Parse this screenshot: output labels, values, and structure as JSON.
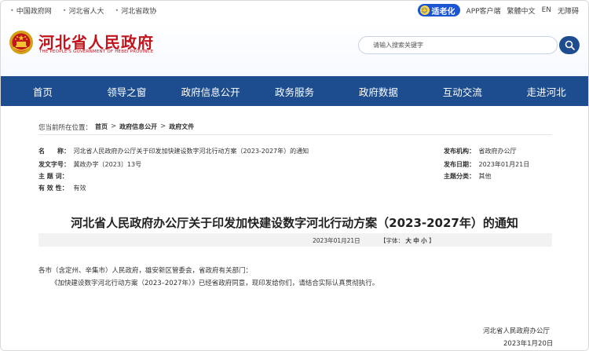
{
  "top_links": [
    "中国政府网",
    "河北省人大",
    "河北省政协"
  ],
  "top_right": {
    "elder_label": "适老化",
    "app": "APP客户端",
    "lang": "繁體中文",
    "en": "EN",
    "accessibility": "无障碍"
  },
  "site": {
    "name_cn": "河北省人民政府",
    "name_en": "THE PEOPLE'S GOVERNMENT OF HEBEI PROVINCE"
  },
  "search": {
    "placeholder": "请输入搜索关键字"
  },
  "nav": [
    "首页",
    "领导之窗",
    "政府信息公开",
    "政务服务",
    "政府数据",
    "互动交流",
    "走进河北"
  ],
  "breadcrumb": {
    "prefix": "您当前所在位置：",
    "items": [
      "首页",
      "政府信息公开",
      "政府文件"
    ],
    "sep": ">"
  },
  "meta": {
    "name_label": "名　　称：",
    "name_value": "河北省人民政府办公厅关于印发加快建设数字河北行动方案（2023-2027年）的通知",
    "docno_label": "发文字号：",
    "docno_value": "冀政办字〔2023〕13号",
    "subject_label": "主 题 词：",
    "subject_value": "",
    "validity_label": "有 效 性：",
    "validity_value": "有效",
    "issuer_label": "发布机构：",
    "issuer_value": "省政府办公厅",
    "date_label": "发布日期：",
    "date_value": "2023年01月21日",
    "category_label": "主题分类：",
    "category_value": "其他"
  },
  "doc": {
    "title": "河北省人民政府办公厅关于印发加快建设数字河北行动方案（2023-2027年）的通知",
    "date": "2023年01月21日",
    "font_label": "【字体：",
    "font_sizes": [
      "大",
      "中",
      "小"
    ],
    "font_close": "】",
    "addressee": "各市（含定州、辛集市）人民政府，雄安新区管委会，省政府有关部门：",
    "body": "《加快建设数字河北行动方案（2023–2027年）》已经省政府同意，现印发给你们，请结合实际认真贯彻执行。",
    "signer": "河北省人民政府办公厅",
    "sign_date": "2023年1月20日"
  },
  "colors": {
    "nav_bg": "#1e4d8f",
    "brand_red": "#c0151b",
    "elder_blue": "#1a55d4"
  }
}
